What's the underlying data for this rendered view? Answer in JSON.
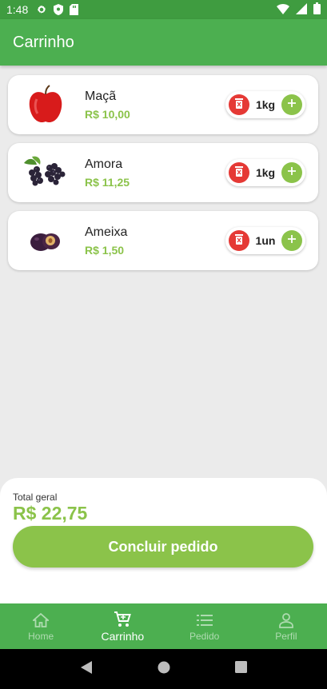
{
  "status_bar": {
    "time": "1:48"
  },
  "app_bar": {
    "title": "Carrinho"
  },
  "cart": {
    "items": [
      {
        "name": "Maçã",
        "price": "R$ 10,00",
        "quantity": "1kg",
        "icon": "apple-icon"
      },
      {
        "name": "Amora",
        "price": "R$ 11,25",
        "quantity": "1kg",
        "icon": "blackberry-icon"
      },
      {
        "name": "Ameixa",
        "price": "R$ 1,50",
        "quantity": "1un",
        "icon": "plum-icon"
      }
    ]
  },
  "summary": {
    "label": "Total geral",
    "total": "R$ 22,75",
    "submit_label": "Concluir pedido"
  },
  "bottom_nav": {
    "items": [
      {
        "label": "Home",
        "icon": "home-icon"
      },
      {
        "label": "Carrinho",
        "icon": "cart-icon"
      },
      {
        "label": "Pedido",
        "icon": "list-icon"
      },
      {
        "label": "Perfil",
        "icon": "person-icon"
      }
    ],
    "active": "Carrinho"
  },
  "colors": {
    "primary": "#4caf50",
    "status_bar": "#3f9c40",
    "accent": "#8bc34a",
    "remove": "#e53935",
    "background": "#ebebeb"
  }
}
